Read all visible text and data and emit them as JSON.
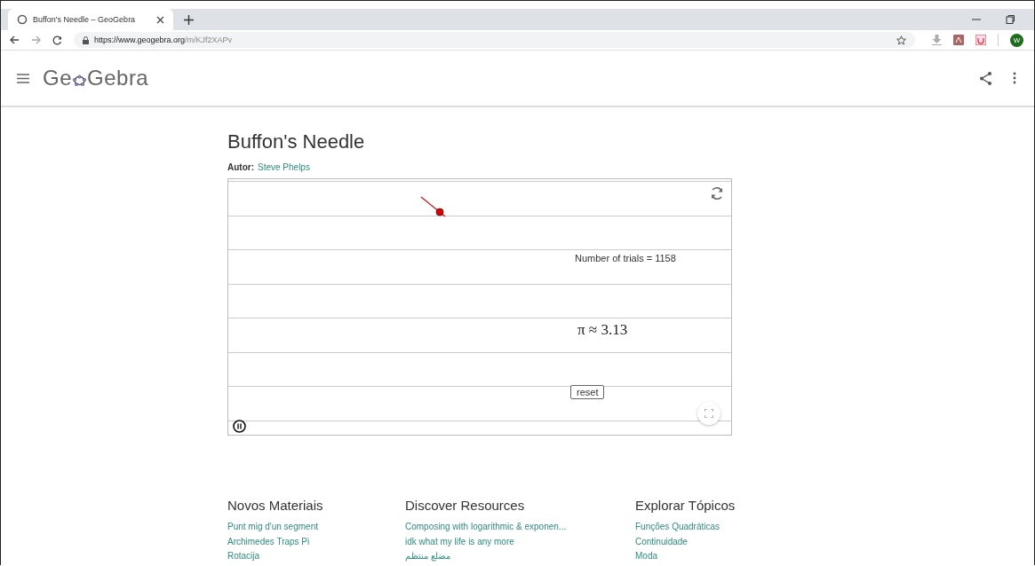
{
  "browser": {
    "tab_title": "Buffon's Needle – GeoGebra",
    "url_host": "https://www.geogebra.org",
    "url_path": "/m/KJf2XAPv",
    "avatar": "W"
  },
  "header": {
    "logo_start": "Ge",
    "logo_end": "Gebra"
  },
  "page": {
    "title": "Buffon's Needle",
    "author_label": "Autor:",
    "author": "Steve Phelps"
  },
  "applet": {
    "trials": "Number of trials = 1158",
    "pi_estimate": "π ≈ 3.13",
    "reset": "reset",
    "playing": true
  },
  "footer": [
    {
      "heading": "Novos Materiais",
      "links": [
        "Punt mig d'un segment",
        "Archimedes Traps Pi",
        "Rotacija"
      ]
    },
    {
      "heading": "Discover Resources",
      "links": [
        "Composing with logarithmic & exponen...",
        "idk what my life is any more",
        "مضلع منتظم"
      ]
    },
    {
      "heading": "Explorar Tópicos",
      "links": [
        "Funções Quadráticas",
        "Continuidade",
        "Moda"
      ]
    }
  ]
}
